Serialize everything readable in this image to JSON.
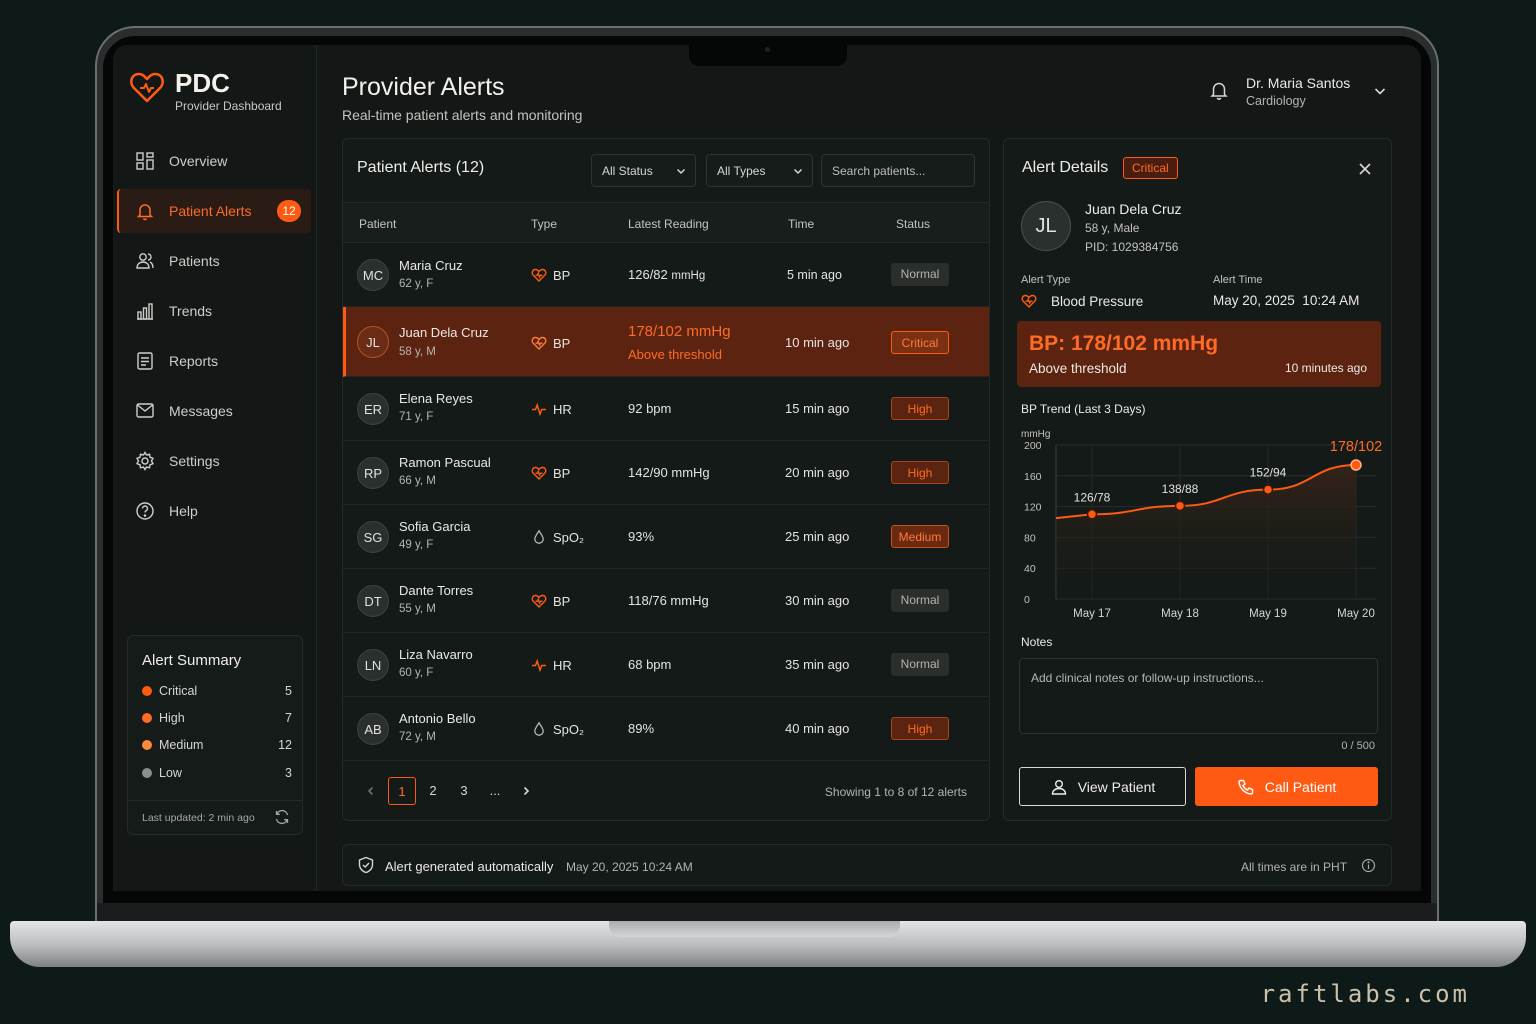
{
  "brand": {
    "title": "PDC",
    "subtitle": "Provider Dashboard",
    "accent": "#ff5a14"
  },
  "nav": [
    {
      "label": "Overview",
      "icon": "grid-icon"
    },
    {
      "label": "Patient Alerts",
      "icon": "bell-icon",
      "badge": "12",
      "active": true
    },
    {
      "label": "Patients",
      "icon": "users-icon"
    },
    {
      "label": "Trends",
      "icon": "bar-chart-icon"
    },
    {
      "label": "Reports",
      "icon": "document-icon"
    },
    {
      "label": "Messages",
      "icon": "mail-icon"
    },
    {
      "label": "Settings",
      "icon": "gear-icon"
    },
    {
      "label": "Help",
      "icon": "help-icon"
    }
  ],
  "summary": {
    "title": "Alert Summary",
    "items": [
      {
        "label": "Critical",
        "count": "5",
        "color": "#ff5a14"
      },
      {
        "label": "High",
        "count": "7",
        "color": "#ff6a26"
      },
      {
        "label": "Medium",
        "count": "12",
        "color": "#ff8a3a"
      },
      {
        "label": "Low",
        "count": "3",
        "color": "#8a8f8c"
      }
    ],
    "updated": "Last updated: 2 min ago"
  },
  "header": {
    "title": "Provider Alerts",
    "subtitle": "Real-time patient alerts and monitoring",
    "user_name": "Dr. Maria Santos",
    "user_role": "Cardiology"
  },
  "alerts": {
    "title": "Patient Alerts (12)",
    "status_filter": "All Status",
    "type_filter": "All Types",
    "search_placeholder": "Search patients...",
    "columns": [
      "Patient",
      "Type",
      "Latest Reading",
      "Time",
      "Status"
    ],
    "rows": [
      {
        "initials": "MC",
        "name": "Maria Cruz",
        "meta": "62 y, F",
        "type": "BP",
        "type_icon": "heart-icon",
        "reading": "126/82",
        "unit": "mmHg",
        "time": "5 min ago",
        "status": "Normal",
        "level": "normal"
      },
      {
        "initials": "JL",
        "name": "Juan Dela Cruz",
        "meta": "58 y, M",
        "type": "BP",
        "type_icon": "heart-icon",
        "reading": "178/102 mmHg",
        "reading_sub": "Above threshold",
        "time": "10 min ago",
        "status": "Critical",
        "level": "critical",
        "selected": true
      },
      {
        "initials": "ER",
        "name": "Elena Reyes",
        "meta": "71 y, F",
        "type": "HR",
        "type_icon": "pulse-icon",
        "reading": "92 bpm",
        "time": "15 min ago",
        "status": "High",
        "level": "high"
      },
      {
        "initials": "RP",
        "name": "Ramon Pascual",
        "meta": "66 y, M",
        "type": "BP",
        "type_icon": "heart-icon",
        "reading": "142/90 mmHg",
        "time": "20 min ago",
        "status": "High",
        "level": "high"
      },
      {
        "initials": "SG",
        "name": "Sofia Garcia",
        "meta": "49 y, F",
        "type": "SpO₂",
        "type_icon": "droplet-icon",
        "reading": "93%",
        "time": "25 min ago",
        "status": "Medium",
        "level": "medium"
      },
      {
        "initials": "DT",
        "name": "Dante Torres",
        "meta": "55 y, M",
        "type": "BP",
        "type_icon": "heart-icon",
        "reading": "118/76 mmHg",
        "time": "30 min ago",
        "status": "Normal",
        "level": "normal"
      },
      {
        "initials": "LN",
        "name": "Liza Navarro",
        "meta": "60 y, F",
        "type": "HR",
        "type_icon": "pulse-icon",
        "reading": "68 bpm",
        "time": "35 min ago",
        "status": "Normal",
        "level": "normal"
      },
      {
        "initials": "AB",
        "name": "Antonio Bello",
        "meta": "72 y, M",
        "type": "SpO₂",
        "type_icon": "droplet-icon",
        "reading": "89%",
        "time": "40 min ago",
        "status": "High",
        "level": "high"
      }
    ],
    "pages": [
      "1",
      "2",
      "3",
      "..."
    ],
    "current_page": "1",
    "showing": "Showing 1 to 8 of 12 alerts"
  },
  "detail": {
    "title": "Alert Details",
    "badge": "Critical",
    "initials": "JL",
    "name": "Juan Dela Cruz",
    "meta": "58 y, Male",
    "pid": "PID: 1029384756",
    "alert_type_label": "Alert Type",
    "alert_type": "Blood Pressure",
    "alert_time_label": "Alert Time",
    "alert_time": "May 20, 2025  10:24 AM",
    "bp_value": "BP: 178/102 mmHg",
    "bp_sub": "Above threshold",
    "bp_ago": "10 minutes ago",
    "trend_title": "BP Trend (Last 3 Days)",
    "notes_label": "Notes",
    "notes_placeholder": "Add clinical notes or follow-up instructions...",
    "notes_count": "0 / 500",
    "view_button": "View Patient",
    "call_button": "Call Patient"
  },
  "chart_data": {
    "type": "line",
    "title": "BP Trend (Last 3 Days)",
    "ylabel": "mmHg",
    "ylim": [
      0,
      200
    ],
    "yticks": [
      0,
      40,
      80,
      120,
      160,
      200
    ],
    "categories": [
      "May 17",
      "May 18",
      "May 19",
      "May 20"
    ],
    "series": [
      {
        "values": [
          110,
          121,
          142,
          174
        ],
        "labels": [
          "126/78",
          "138/88",
          "152/94",
          "178/102"
        ]
      }
    ],
    "grid": true
  },
  "footer": {
    "text": "Alert generated automatically",
    "time": "May 20, 2025 10:24 AM",
    "timezone": "All times are in PHT"
  },
  "watermark": "raftlabs.com"
}
